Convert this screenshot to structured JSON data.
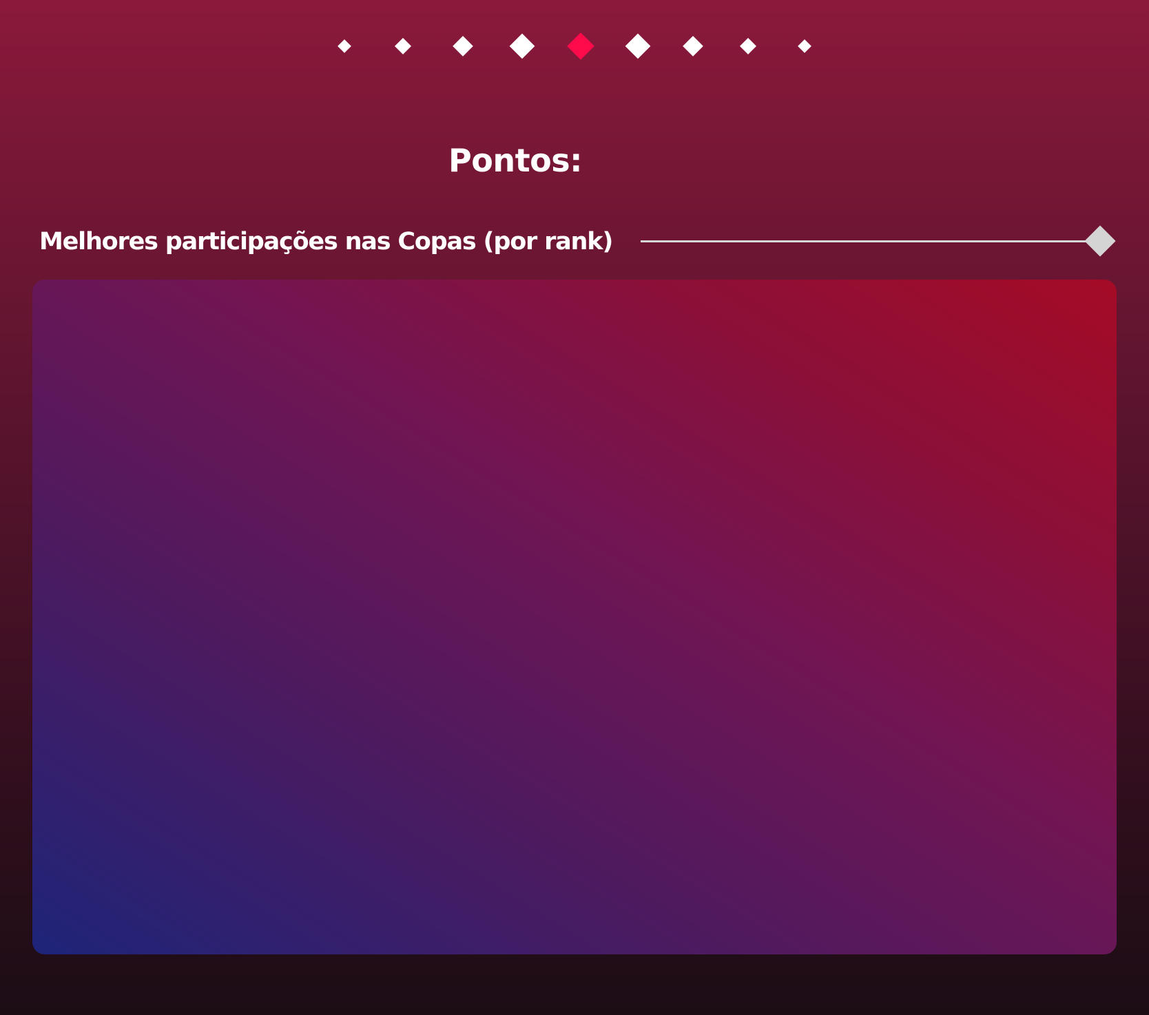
{
  "pagination": {
    "total_pages": 9,
    "current_page": 5,
    "active_color": "#ff0a4a",
    "inactive_color": "#ffffff"
  },
  "title": "Pontos:",
  "section": {
    "label": "Melhores participações nas Copas (por rank)",
    "divider_color": "#d8d8d8"
  },
  "panel": {
    "gradient_colors": [
      "#1e2479",
      "#4f1a5e",
      "#721553",
      "#8a1039",
      "#a50b26"
    ]
  }
}
